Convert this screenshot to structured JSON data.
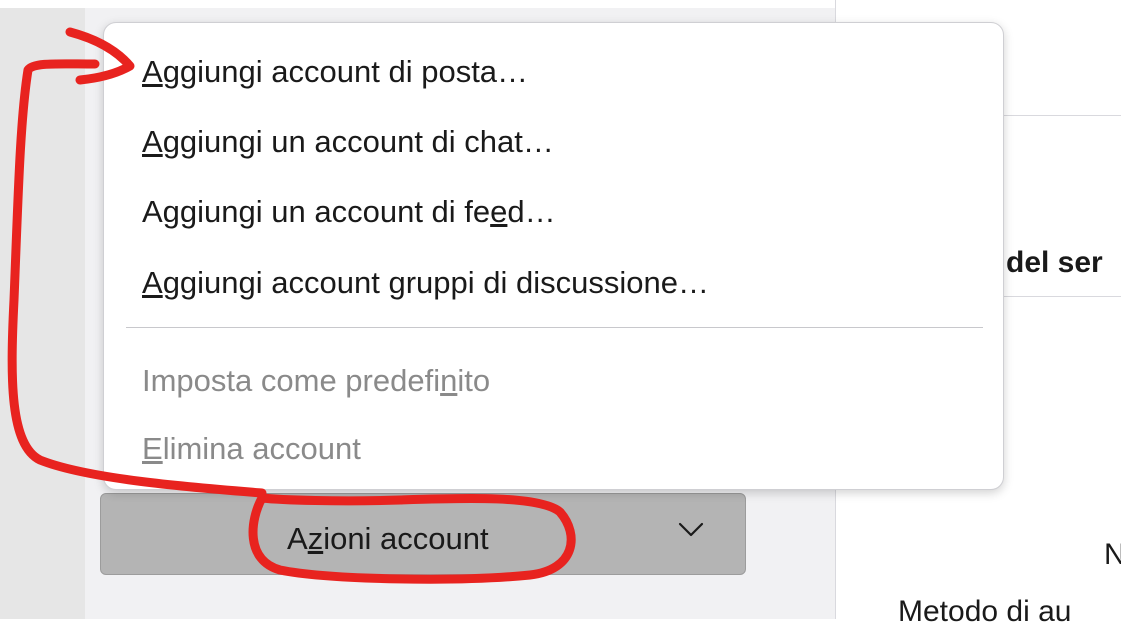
{
  "menu": {
    "items": [
      {
        "label": "Aggiungi account di posta…",
        "enabled": true
      },
      {
        "label": "Aggiungi un account di chat…",
        "enabled": true
      },
      {
        "label": "Aggiungi un account di feed…",
        "enabled": true
      },
      {
        "label": "Aggiungi account gruppi di discussione…",
        "enabled": true
      },
      {
        "label": "Imposta come predefinito",
        "enabled": false
      },
      {
        "label": "Elimina account",
        "enabled": false
      }
    ]
  },
  "actions_button": {
    "label": "Azioni account",
    "icon": "chevron-down-icon"
  },
  "content": {
    "section_heading": "del ser",
    "field_a": "N",
    "field_b": "Metodo di au"
  },
  "annotation": {
    "color": "#e8231f",
    "shape": "freehand arrow from Azioni account button to first menu item"
  },
  "colors": {
    "button_bg": "#b4b4b4",
    "disabled_text": "#8a8a8a",
    "sidebar_bg": "#f1f1f3"
  }
}
